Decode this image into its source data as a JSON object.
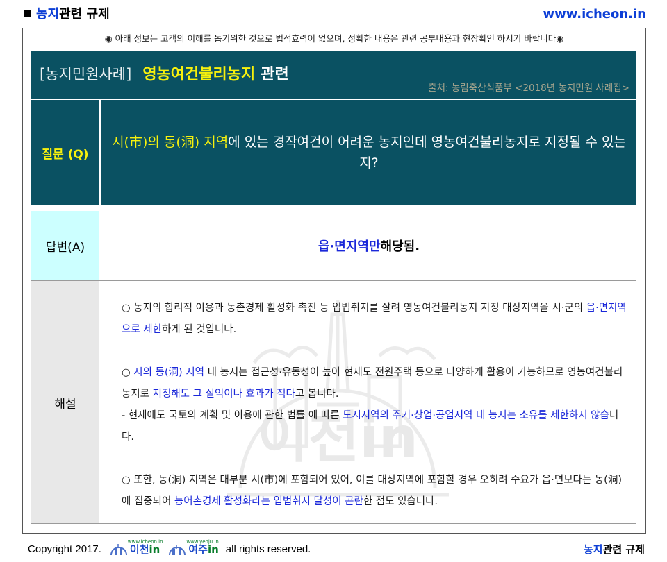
{
  "header": {
    "title_blue": "농지",
    "title_rest": "관련 규제",
    "site": "www.icheon.in"
  },
  "notice": "◉ 아래 정보는 고객의 이해를 돕기위한 것으로 법적효력이 없으며, 정확한 내용은 관련 공부내용과 현장확인 하시기 바랍니다◉",
  "title_box": {
    "bracket": "[농지민원사례]",
    "highlight": "영농여건불리농지",
    "suffix": "관련",
    "source": "출처: 농림축산식품부 <2018년 농지민원 사례집>"
  },
  "question": {
    "label": "질문 (Q)",
    "highlight": "시(市)의 동(洞) 지역",
    "text": "에 있는 경작여건이 어려운 농지인데 영농여건불리농지로 지정될 수 있는지?"
  },
  "answer": {
    "label": "답변(A)",
    "highlight": "읍·면지역만",
    "text": " 해당됨."
  },
  "explanation": {
    "label": "해설",
    "p1_a": "○ 농지의 합리적 이용과 농촌경제 활성화 촉진 등 입법취지를 살려 영농여건불리농지 지정 대상지역을 시·군의 ",
    "p1_hl": "읍·면지역으로 제한",
    "p1_b": "하게 된 것입니다.",
    "p2_a": "○ ",
    "p2_hl1": "시의 동(洞) 지역",
    "p2_b": " 내 농지는 접근성·유동성이 높아 현재도 전원주택 등으로 다양하게 활용이 가능하므로 영농여건불리농지로 ",
    "p2_hl2": "지정해도 그 실익이나 효과가 적다",
    "p2_c": "고 봅니다.",
    "p3_a": "- 현재에도  국토의 계획 및 이용에 관한 법률 에 따른 ",
    "p3_hl": "도시지역의 주거·상업·공업지역 내 농지는 소유를 제한하지 않습",
    "p3_b": "니다.",
    "p4_a": "○ 또한, 동(洞) 지역은 대부분 시(市)에 포함되어 있어, 이를 대상지역에 포함할 경우 오히려 수요가 읍·면보다는 동(洞)에 집중되어 ",
    "p4_hl": "농어촌경제 활성화라는 입법취지 달성이 곤란",
    "p4_b": "한 점도 있습니다.",
    "watermark": "이천in"
  },
  "footer": {
    "copyright": "Copyright 2017.",
    "logo1_small": "www.icheon.in",
    "logo1": "이천",
    "logo1_in": "in",
    "logo2_small": "www.yeoju.in",
    "logo2": "여주",
    "logo2_in": "in",
    "rights": "all rights reserved.",
    "right_blue": "농지",
    "right_rest": "관련 규제"
  },
  "colors": {
    "teal": "#0a5162",
    "yellow": "#f7f10d",
    "blue": "#1a27d9",
    "answer_bg": "#ccffff",
    "explain_bg": "#e8e8e8"
  }
}
